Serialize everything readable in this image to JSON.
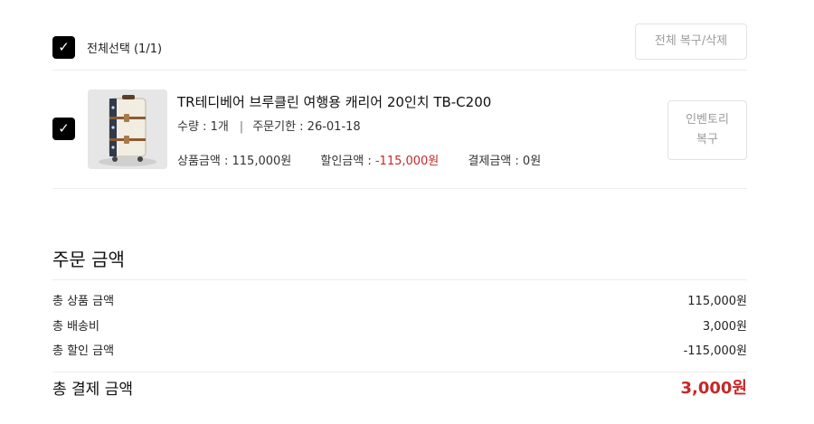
{
  "cart": {
    "select_all": {
      "checked": true,
      "check_glyph": "✓",
      "label": "전체선택 (1/1)",
      "restore_delete_button": "전체 복구/삭제"
    },
    "items": [
      {
        "checked": true,
        "check_glyph": "✓",
        "thumbnail_icon": "suitcase-image",
        "title": "TR테디베어 브루클린 여행용 캐리어 20인치 TB-C200",
        "quantity_text": "수량 : 1개",
        "separator": "|",
        "deadline_text": "주문기한 : 26-01-18",
        "product_price_label": "상품금액 : ",
        "product_price_value": "115,000원",
        "discount_label": "할인금액 : ",
        "discount_value": "-115,000원",
        "payment_label": "결제금액 : ",
        "payment_value": "0원",
        "restore_button_line1": "인벤토리",
        "restore_button_line2": "복구"
      }
    ]
  },
  "summary": {
    "title": "주문 금액",
    "lines": [
      {
        "label": "총 상품 금액",
        "value": "115,000원"
      },
      {
        "label": "총 배송비",
        "value": "3,000원"
      },
      {
        "label": "총 할인 금액",
        "value": "-115,000원"
      }
    ],
    "total_label": "총 결제 금액",
    "total_value": "3,000원"
  },
  "colors": {
    "accent_red": "#c62828",
    "checkbox_black": "#000000",
    "border_gray": "#e2e2e2",
    "muted_text": "#9b9b9b"
  }
}
